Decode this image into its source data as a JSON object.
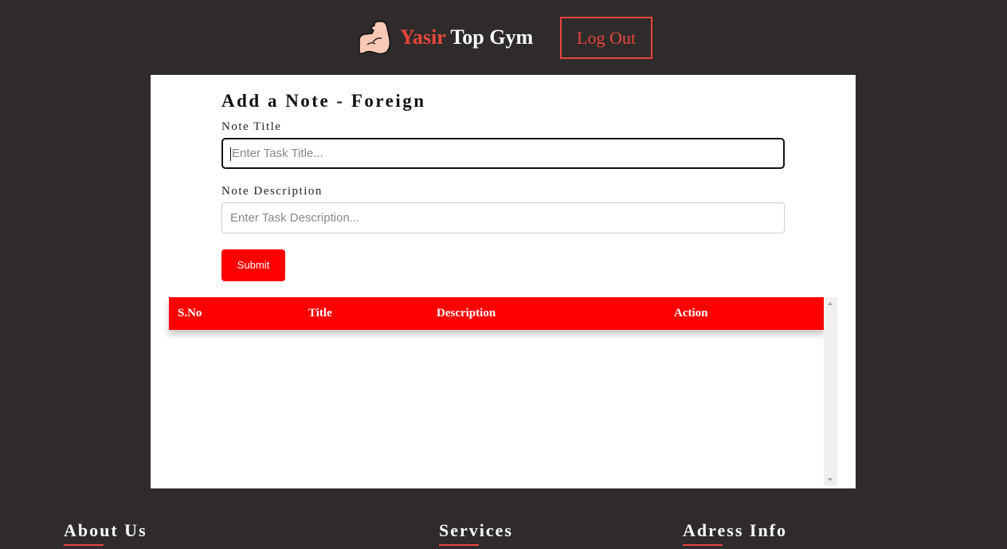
{
  "header": {
    "logo_icon": "flexed-biceps-icon",
    "brand_first": "Yasir",
    "brand_rest": "Top Gym",
    "logout_label": "Log Out"
  },
  "form": {
    "title": "Add a Note - Foreign",
    "note_title_label": "Note Title",
    "note_title_placeholder": "Enter Task Title...",
    "note_title_value": "",
    "note_desc_label": "Note Description",
    "note_desc_placeholder": "Enter Task Description...",
    "note_desc_value": "",
    "submit_label": "Submit"
  },
  "table": {
    "columns": [
      "S.No",
      "Title",
      "Description",
      "Action"
    ],
    "rows": []
  },
  "footer": {
    "headings": [
      "About Us",
      "Services",
      "Adress Info"
    ]
  },
  "colors": {
    "background": "#2f2b2b",
    "accent": "#e8453c",
    "primary_red": "#ff0000",
    "card": "#ffffff"
  }
}
